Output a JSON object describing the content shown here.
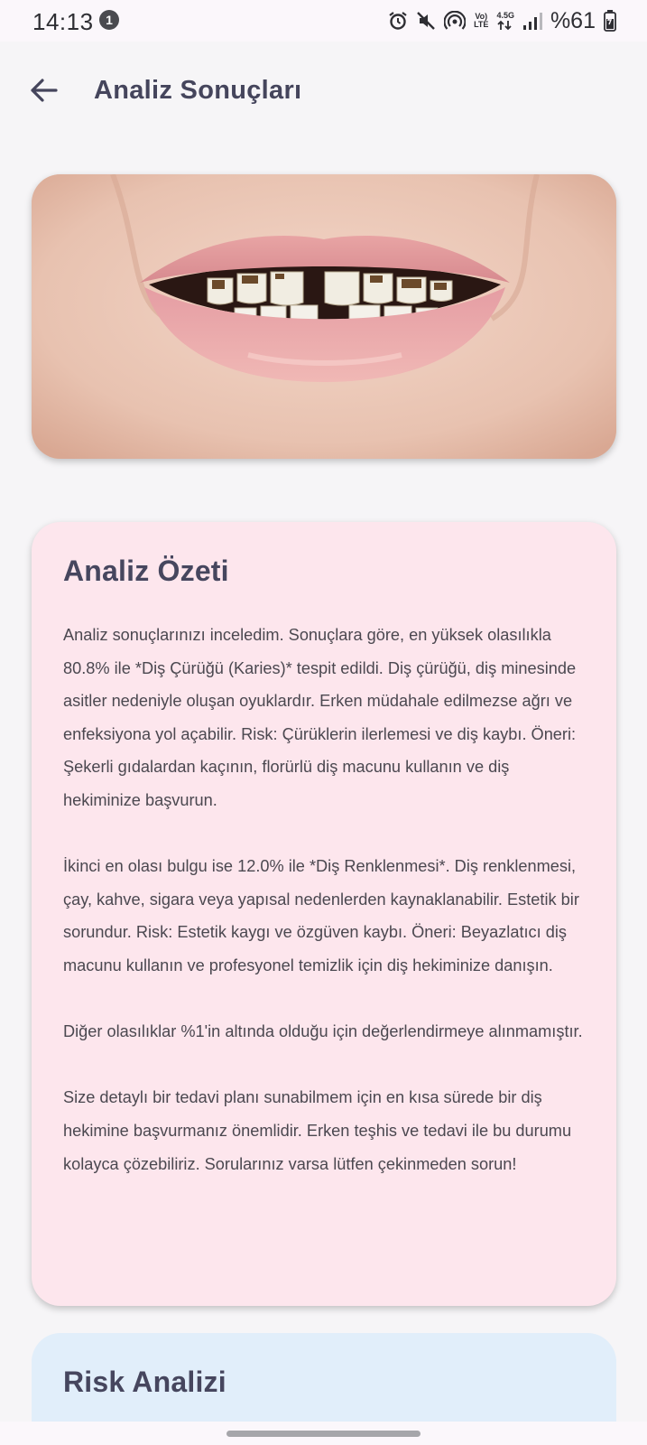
{
  "status_bar": {
    "time": "14:13",
    "notification_count": "1",
    "network_volte": "Vo)",
    "network_lte": "LTE",
    "network_type": "4.5G",
    "battery": "%61",
    "icons": [
      "alarm-icon",
      "mute-icon",
      "hotspot-icon",
      "volte-icon",
      "data-arrows-icon",
      "signal-icon",
      "battery-icon"
    ]
  },
  "header": {
    "title": "Analiz Sonuçları",
    "back_icon": "arrow-left-icon"
  },
  "photo": {
    "description_icon": "dental-photo"
  },
  "summary": {
    "title": "Analiz Özeti",
    "paragraphs": [
      "Analiz sonuçlarınızı inceledim. Sonuçlara göre, en yüksek olasılıkla 80.8% ile *Diş Çürüğü (Karies)* tespit edildi. Diş çürüğü, diş minesinde asitler nedeniyle oluşan oyuklardır. Erken müdahale edilmezse ağrı ve enfeksiyona yol açabilir. Risk: Çürüklerin ilerlemesi ve diş kaybı. Öneri: Şekerli gıdalardan kaçının, florürlü diş macunu kullanın ve diş hekiminize başvurun.",
      "İkinci en olası bulgu ise 12.0% ile *Diş Renklenmesi*. Diş renklenmesi, çay, kahve, sigara veya yapısal nedenlerden kaynaklanabilir. Estetik bir sorundur. Risk: Estetik kaygı ve özgüven kaybı. Öneri: Beyazlatıcı diş macunu kullanın ve profesyonel temizlik için diş hekiminize danışın.",
      "Diğer olasılıklar %1'in altında olduğu için değerlendirmeye alınmamıştır.",
      "Size detaylı bir tedavi planı sunabilmem için en kısa sürede bir diş hekimine başvurmanız önemlidir. Erken teşhis ve tedavi ile bu durumu kolayca çözebiliriz. Sorularınız varsa lütfen çekinmeden sorun!"
    ]
  },
  "risk": {
    "title": "Risk Analizi"
  },
  "colors": {
    "summary_bg": "#fde6ed",
    "risk_bg": "#e1eefa",
    "title_text": "#46465e",
    "page_bg": "#f6f5f7"
  }
}
